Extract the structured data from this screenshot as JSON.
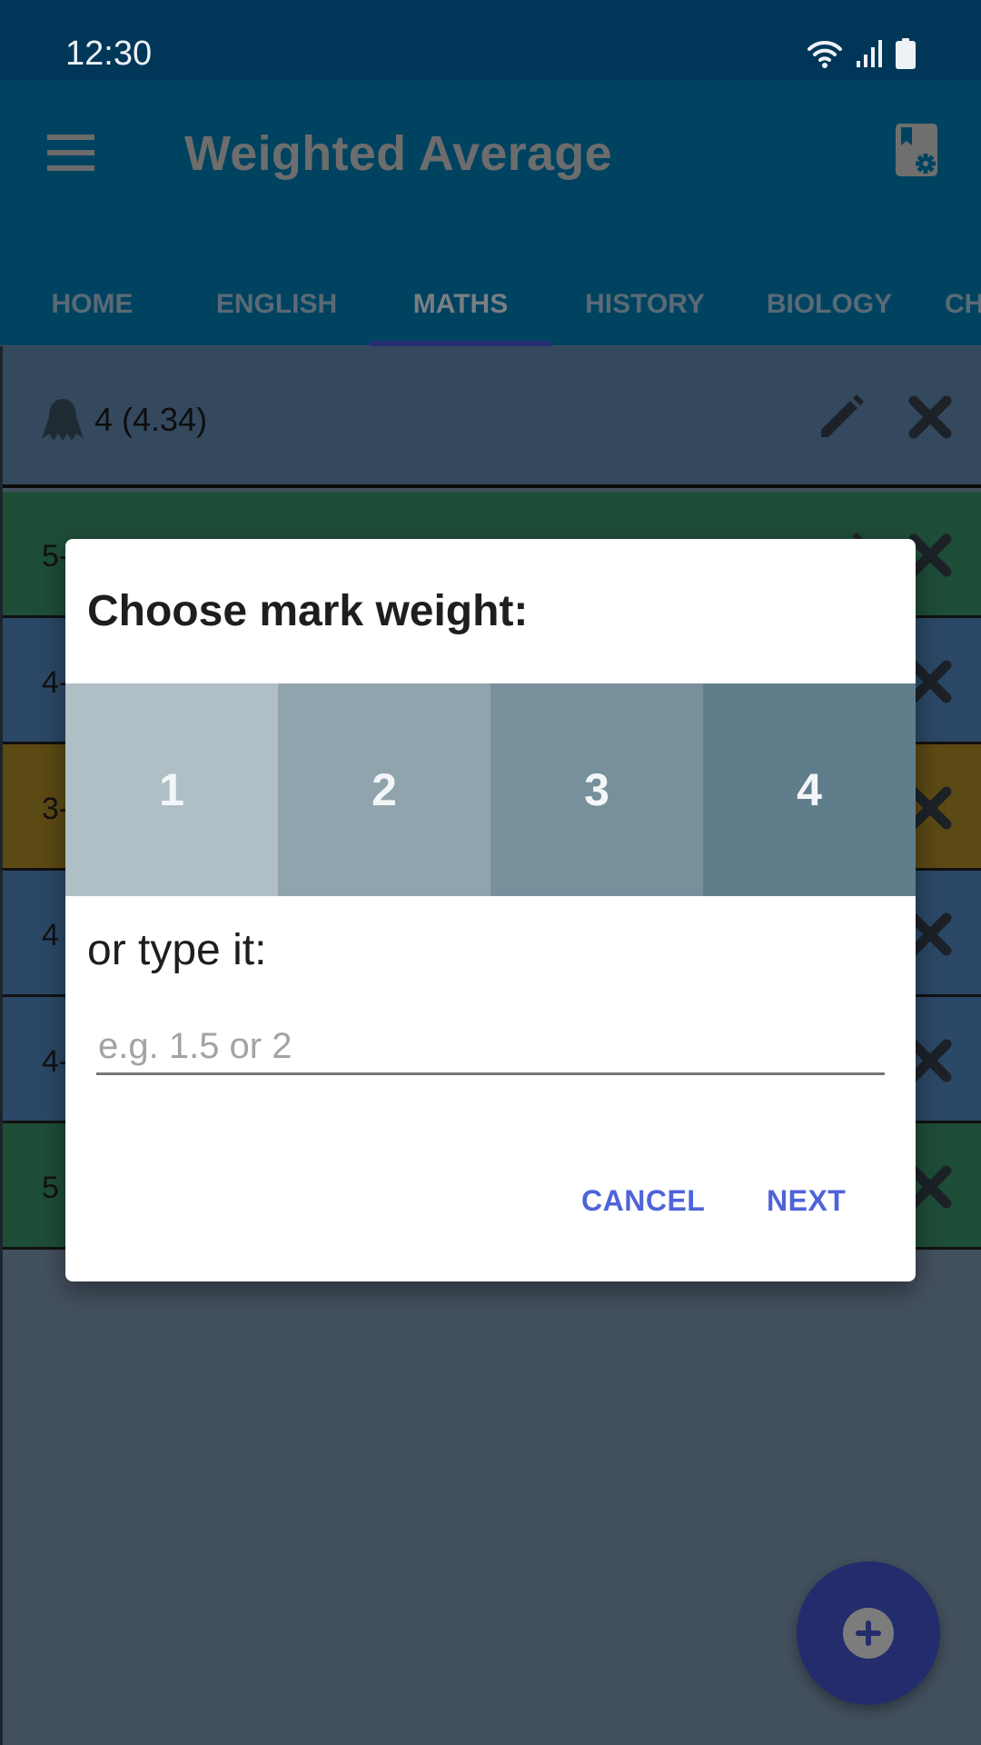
{
  "status_bar": {
    "time": "12:30",
    "icons": [
      "wifi-icon",
      "signal-icon",
      "battery-icon"
    ]
  },
  "app_bar": {
    "menu_icon": "menu-icon",
    "title": "Weighted Average",
    "settings_icon": "book-settings-icon"
  },
  "tabs": [
    {
      "label": "HOME",
      "active": false
    },
    {
      "label": "ENGLISH",
      "active": false
    },
    {
      "label": "MATHS",
      "active": true
    },
    {
      "label": "HISTORY",
      "active": false
    },
    {
      "label": "BIOLOGY",
      "active": false
    },
    {
      "label": "CH",
      "active": false
    }
  ],
  "summary": {
    "icon": "ribbon-icon",
    "text": "4 (4.34)"
  },
  "marks": [
    {
      "text": "5-",
      "color": "#1e4d38"
    },
    {
      "text": "4-",
      "color": "#2b4866"
    },
    {
      "text": "3-",
      "color": "#5c4a14"
    },
    {
      "text": "4",
      "color": "#2b4866"
    },
    {
      "text": "4-",
      "color": "#2b4866"
    },
    {
      "text": "5",
      "color": "#1e4d38"
    }
  ],
  "dialog": {
    "title": "Choose mark weight:",
    "weights": [
      {
        "label": "1",
        "color": "#b0bec5"
      },
      {
        "label": "2",
        "color": "#90a4ae"
      },
      {
        "label": "3",
        "color": "#78909c"
      },
      {
        "label": "4",
        "color": "#607d8b"
      }
    ],
    "type_label": "or type it:",
    "input_placeholder": "e.g. 1.5 or 2",
    "input_value": "",
    "cancel_label": "CANCEL",
    "next_label": "NEXT"
  },
  "fab": {
    "icon": "add-icon"
  }
}
